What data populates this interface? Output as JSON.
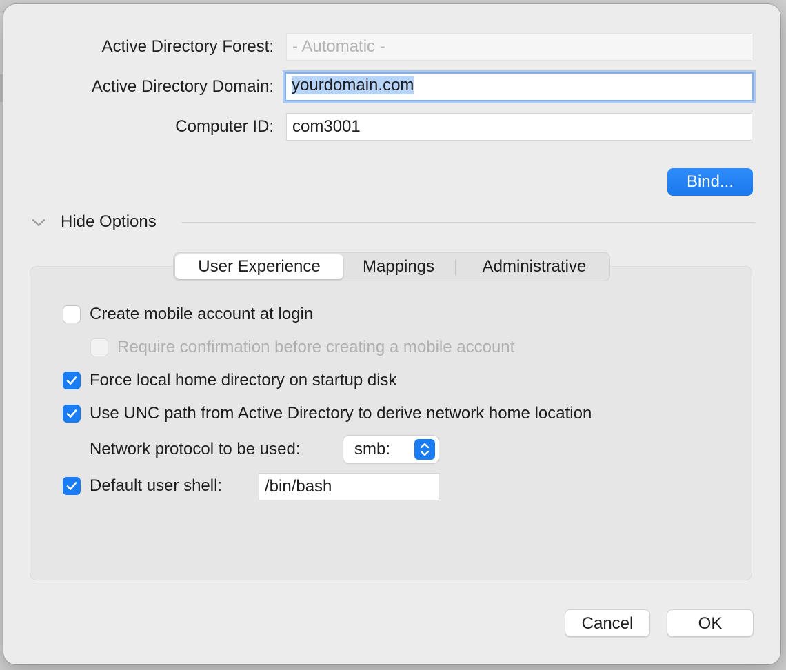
{
  "form": {
    "forest_label": "Active Directory Forest:",
    "forest_placeholder": "- Automatic -",
    "domain_label": "Active Directory Domain:",
    "domain_value": "yourdomain.com",
    "computer_label": "Computer ID:",
    "computer_value": "com3001",
    "bind_label": "Bind..."
  },
  "options": {
    "toggle_label": "Hide Options",
    "tabs": [
      {
        "label": "User Experience",
        "active": true
      },
      {
        "label": "Mappings",
        "active": false
      },
      {
        "label": "Administrative",
        "active": false
      }
    ]
  },
  "user_experience": {
    "mobile_account": {
      "label": "Create mobile account at login",
      "checked": false
    },
    "require_confirmation": {
      "label": "Require confirmation before creating a mobile account",
      "checked": false,
      "enabled": false
    },
    "force_local_home": {
      "label": "Force local home directory on startup disk",
      "checked": true
    },
    "use_unc_path": {
      "label": "Use UNC path from Active Directory to derive network home location",
      "checked": true
    },
    "protocol_label": "Network protocol to be used:",
    "protocol_value": "smb:",
    "default_shell": {
      "label": "Default user shell:",
      "checked": true,
      "value": "/bin/bash"
    }
  },
  "footer": {
    "cancel_label": "Cancel",
    "ok_label": "OK"
  },
  "colors": {
    "accent": "#1a7cf2",
    "background": "#ececec"
  }
}
